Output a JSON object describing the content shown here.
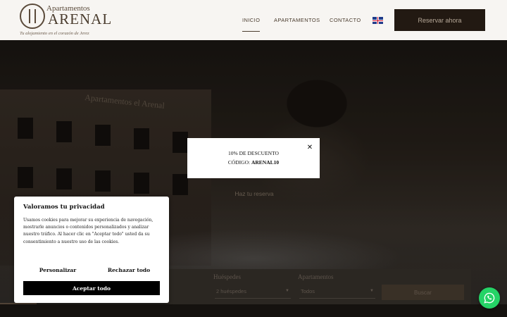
{
  "brand": {
    "name_line1": "Apartamentos",
    "name_line2": "ARENAL",
    "tagline": "Tu alojamiento en el corazón de Jerez"
  },
  "nav": {
    "items": [
      {
        "label": "INICIO",
        "active": true
      },
      {
        "label": "APARTAMENTOS",
        "active": false
      },
      {
        "label": "CONTACTO",
        "active": false
      }
    ],
    "language_flag": "uk-flag-icon",
    "reserve_label": "Reservar ahora"
  },
  "hero": {
    "sign_text": "Apartamentos el Arenal",
    "cta_label": "Haz tu reserva"
  },
  "booking": {
    "guests_label": "Huéspedes",
    "guests_value": "2 huéspedes",
    "apartments_label": "Apartamentos",
    "apartments_value": "Todos",
    "search_label": "Buscar"
  },
  "discount_popup": {
    "line1": "10% DE DESCUENTO",
    "line2_prefix": "CÓDIGO: ",
    "code": "ARENAL10",
    "close_icon": "close-icon"
  },
  "cookie_banner": {
    "title": "Valoramos tu privacidad",
    "body": "Usamos cookies para mejorar su experiencia de navegación, mostrarle anuncios o contenidos personalizados y analizar nuestro tráfico. Al hacer clic en \"Aceptar todo\" usted da su consentimiento a nuestro uso de las cookies.",
    "customize_label": "Personalizar",
    "reject_label": "Rechazar todo",
    "accept_label": "Aceptar todo"
  },
  "colors": {
    "header_bg": "#f7f5f2",
    "reserve_button_bg": "#221912",
    "whatsapp_green": "#25d366"
  },
  "widgets": {
    "whatsapp_icon": "whatsapp-icon"
  }
}
